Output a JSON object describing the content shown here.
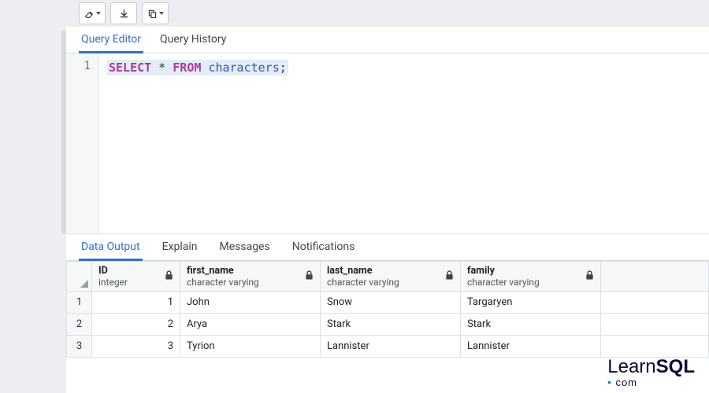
{
  "toolbar": {
    "icons": [
      "eraser",
      "download",
      "copy"
    ]
  },
  "query_tabs": {
    "active": 0,
    "items": [
      "Query Editor",
      "Query History"
    ]
  },
  "editor": {
    "line_number": "1",
    "sql": {
      "kw1": "SELECT",
      "star": "*",
      "kw2": "FROM",
      "table": "characters",
      "semi": ";"
    }
  },
  "result_tabs": {
    "active": 0,
    "items": [
      "Data Output",
      "Explain",
      "Messages",
      "Notifications"
    ]
  },
  "columns": [
    {
      "name": "ID",
      "type": "integer"
    },
    {
      "name": "first_name",
      "type": "character varying"
    },
    {
      "name": "last_name",
      "type": "character varying"
    },
    {
      "name": "family",
      "type": "character varying"
    }
  ],
  "rows": [
    {
      "n": "1",
      "id": "1",
      "first_name": "John",
      "last_name": "Snow",
      "family": "Targaryen"
    },
    {
      "n": "2",
      "id": "2",
      "first_name": "Arya",
      "last_name": "Stark",
      "family": "Stark"
    },
    {
      "n": "3",
      "id": "3",
      "first_name": "Tyrion",
      "last_name": "Lannister",
      "family": "Lannister"
    }
  ],
  "watermark": {
    "brand_a": "Learn",
    "brand_b": "SQL",
    "sub": "com"
  }
}
